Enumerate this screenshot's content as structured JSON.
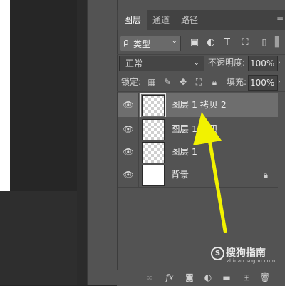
{
  "panel": {
    "tabs": [
      "图层",
      "通道",
      "路径"
    ],
    "active_tab": "图层",
    "menu_icon": "panel-menu-icon"
  },
  "filter": {
    "kind_label": "类型",
    "kind_prefix": "ρ",
    "icons": [
      "image-filter-icon",
      "adjustment-filter-icon",
      "type-filter-icon",
      "shape-filter-icon",
      "smart-object-filter-icon"
    ]
  },
  "blend": {
    "mode": "正常",
    "opacity_label": "不透明度:",
    "opacity_value": "100%"
  },
  "lock": {
    "label": "锁定:",
    "fill_label": "填充:",
    "fill_value": "100%"
  },
  "layers": [
    {
      "name": "图层 1 拷贝 2",
      "type": "transparent",
      "selected": true
    },
    {
      "name": "图层 1 拷贝",
      "type": "transparent",
      "selected": false
    },
    {
      "name": "图层 1",
      "type": "transparent",
      "selected": false
    },
    {
      "name": "背景",
      "type": "white",
      "selected": false,
      "locked": true
    }
  ],
  "toolbar": {
    "fx_label": "fx"
  },
  "watermark": {
    "main": "搜狗指南",
    "sub": "zhinan.sogou.com"
  },
  "colors": {
    "arrow": "#f2f200",
    "panel_bg": "#535353",
    "selected_row": "#6e6e6e"
  }
}
